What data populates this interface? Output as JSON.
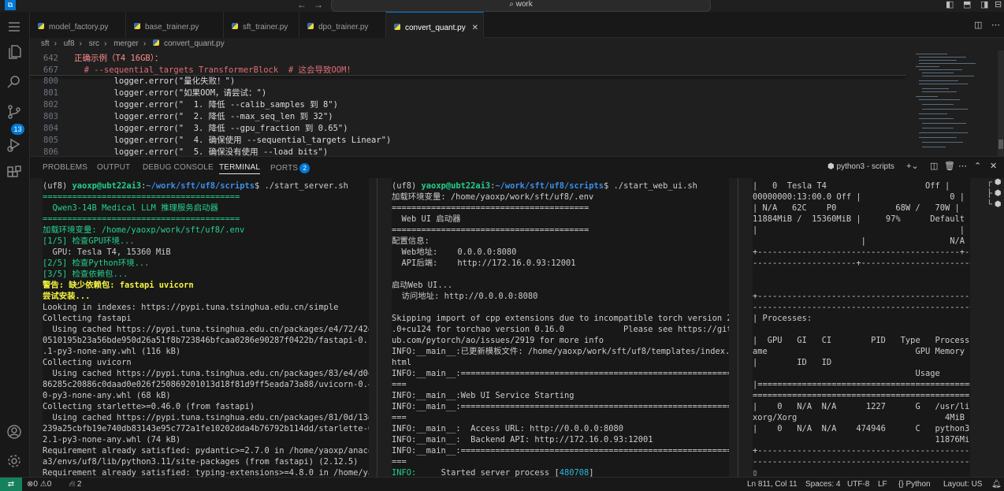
{
  "titlebar": {
    "search": "work"
  },
  "tabs": [
    {
      "label": "model_factory.py"
    },
    {
      "label": "base_trainer.py"
    },
    {
      "label": "sft_trainer.py"
    },
    {
      "label": "dpo_trainer.py"
    },
    {
      "label": "convert_quant.py",
      "active": true
    }
  ],
  "breadcrumb": [
    "sft",
    "uf8",
    "src",
    "merger",
    "convert_quant.py"
  ],
  "activity": {
    "scm_badge": "13"
  },
  "editor": {
    "sticky": [
      {
        "num": "642",
        "text": "正确示例（T4 16GB）："
      },
      {
        "num": "667",
        "text": "  # --sequential_targets TransformerBlock  # 这会导致OOM!"
      }
    ],
    "lines": [
      {
        "num": "800",
        "text": "        logger.error(\"量化失败！\")"
      },
      {
        "num": "801",
        "text": "        logger.error(\"如果OOM，请尝试：\")"
      },
      {
        "num": "802",
        "text": "        logger.error(\"  1. 降低 --calib_samples 到 8\")"
      },
      {
        "num": "803",
        "text": "        logger.error(\"  2. 降低 --max_seq_len 到 32\")"
      },
      {
        "num": "804",
        "text": "        logger.error(\"  3. 降低 --gpu_fraction 到 0.65\")"
      },
      {
        "num": "805",
        "text": "        logger.error(\"  4. 确保使用 --sequential_targets Linear\")"
      },
      {
        "num": "806",
        "text": "        logger.error(\"  5. 确保没有使用 --load_bits\")"
      }
    ]
  },
  "panel": {
    "tabs": [
      "PROBLEMS",
      "OUTPUT",
      "DEBUG CONSOLE",
      "TERMINAL",
      "PORTS"
    ],
    "ports_badge": "2",
    "terminal_selector": "python3 - scripts"
  },
  "terminal1": [
    [
      {
        "t": "(uf8) ",
        "c": "white"
      },
      {
        "t": "yaoxp@ubt22ai3",
        "c": "bgreen"
      },
      {
        "t": ":",
        "c": "white"
      },
      {
        "t": "~/work/sft/uf8/scripts",
        "c": "bblue"
      },
      {
        "t": "$ ./start_server.sh",
        "c": "white"
      }
    ],
    [
      {
        "t": "========================================",
        "c": "green"
      }
    ],
    [
      {
        "t": "  Qwen3-14B Medical LLM 推理服务启动器",
        "c": "green"
      }
    ],
    [
      {
        "t": "========================================",
        "c": "green"
      }
    ],
    [
      {
        "t": "加载环境变量: /home/yaoxp/work/sft/uf8/.env",
        "c": "green"
      }
    ],
    [
      {
        "t": "[1/5] 检查GPU环境...",
        "c": "green"
      }
    ],
    [
      {
        "t": "  GPU: Tesla T4, 15360 MiB",
        "c": "white"
      }
    ],
    [
      {
        "t": "[2/5] 检查Python环境...",
        "c": "green"
      }
    ],
    [
      {
        "t": "[3/5] 检查依赖包...",
        "c": "green"
      }
    ],
    [
      {
        "t": "警告: 缺少依赖包: fastapi uvicorn",
        "c": "yellow"
      }
    ],
    [
      {
        "t": "尝试安装...",
        "c": "yellow"
      }
    ],
    [
      {
        "t": "Looking in indexes: https://pypi.tuna.tsinghua.edu.cn/simple",
        "c": "white"
      }
    ],
    [
      {
        "t": "Collecting fastapi",
        "c": "white"
      }
    ],
    [
      {
        "t": "  Using cached https://pypi.tuna.tsinghua.edu.cn/packages/e4/72/42e90",
        "c": "white"
      }
    ],
    [
      {
        "t": "0510195b23a56bde950d26a51f8b723846bfcaa0286e90287f0422b/fastapi-0.135",
        "c": "white"
      }
    ],
    [
      {
        "t": ".1-py3-none-any.whl (116 kB)",
        "c": "white"
      }
    ],
    [
      {
        "t": "Collecting uvicorn",
        "c": "white"
      }
    ],
    [
      {
        "t": "  Using cached https://pypi.tuna.tsinghua.edu.cn/packages/83/e4/d04a0",
        "c": "white"
      }
    ],
    [
      {
        "t": "86285c20886c0daad0e026f250869201013d18f81d9ff5eada73a88/uvicorn-0.41.",
        "c": "white"
      }
    ],
    [
      {
        "t": "0-py3-none-any.whl (68 kB)",
        "c": "white"
      }
    ],
    [
      {
        "t": "Collecting starlette>=0.46.0 (from fastapi)",
        "c": "white"
      }
    ],
    [
      {
        "t": "  Using cached https://pypi.tuna.tsinghua.edu.cn/packages/81/0d/13d1d",
        "c": "white"
      }
    ],
    [
      {
        "t": "239a25cbfb19e740db83143e95c772a1fe10202dda4b76792b114dd/starlette-0.5",
        "c": "white"
      }
    ],
    [
      {
        "t": "2.1-py3-none-any.whl (74 kB)",
        "c": "white"
      }
    ],
    [
      {
        "t": "Requirement already satisfied: pydantic>=2.7.0 in /home/yaoxp/anacond",
        "c": "white"
      }
    ],
    [
      {
        "t": "a3/envs/uf8/lib/python3.11/site-packages (from fastapi) (2.12.5)",
        "c": "white"
      }
    ],
    [
      {
        "t": "Requirement already satisfied: typing-extensions>=4.8.0 in /home/yaox",
        "c": "white"
      }
    ]
  ],
  "terminal2": [
    [
      {
        "t": "(uf8) ",
        "c": "white"
      },
      {
        "t": "yaoxp@ubt22ai3",
        "c": "bgreen"
      },
      {
        "t": ":",
        "c": "white"
      },
      {
        "t": "~/work/sft/uf8/scripts",
        "c": "bblue"
      },
      {
        "t": "$ ./start_web_ui.sh",
        "c": "white"
      }
    ],
    [
      {
        "t": "加载环境变量: /home/yaoxp/work/sft/uf8/.env",
        "c": "white"
      }
    ],
    [
      {
        "t": "========================================",
        "c": "white"
      }
    ],
    [
      {
        "t": "  Web UI 启动器",
        "c": "white"
      }
    ],
    [
      {
        "t": "========================================",
        "c": "white"
      }
    ],
    [
      {
        "t": "配置信息:",
        "c": "white"
      }
    ],
    [
      {
        "t": "  Web地址:    0.0.0.0:8080",
        "c": "white"
      }
    ],
    [
      {
        "t": "  API后端:    http://172.16.0.93:12001",
        "c": "white"
      }
    ],
    [
      {
        "t": "",
        "c": "white"
      }
    ],
    [
      {
        "t": "启动Web UI...",
        "c": "white"
      }
    ],
    [
      {
        "t": "  访问地址: http://0.0.0.0:8080",
        "c": "white"
      }
    ],
    [
      {
        "t": "",
        "c": "white"
      }
    ],
    [
      {
        "t": "Skipping import of cpp extensions due to incompatible torch version 2.6",
        "c": "white"
      }
    ],
    [
      {
        "t": ".0+cu124 for torchao version 0.16.0            Please see https://gith",
        "c": "white"
      }
    ],
    [
      {
        "t": "ub.com/pytorch/ao/issues/2919 for more info",
        "c": "white"
      }
    ],
    [
      {
        "t": "INFO:__main__:已更新模板文件: /home/yaoxp/work/sft/uf8/templates/index.",
        "c": "white"
      }
    ],
    [
      {
        "t": "html",
        "c": "white"
      }
    ],
    [
      {
        "t": "INFO:__main__:==========================================================",
        "c": "white"
      }
    ],
    [
      {
        "t": "===",
        "c": "white"
      }
    ],
    [
      {
        "t": "INFO:__main__:Web UI Service Starting",
        "c": "white"
      }
    ],
    [
      {
        "t": "INFO:__main__:==========================================================",
        "c": "white"
      }
    ],
    [
      {
        "t": "===",
        "c": "white"
      }
    ],
    [
      {
        "t": "INFO:__main__:  Access URL: http://0.0.0.0:8080",
        "c": "white"
      }
    ],
    [
      {
        "t": "INFO:__main__:  Backend API: http://172.16.0.93:12001",
        "c": "white"
      }
    ],
    [
      {
        "t": "INFO:__main__:==========================================================",
        "c": "white"
      }
    ],
    [
      {
        "t": "===",
        "c": "white"
      }
    ],
    [
      {
        "t": "INFO:     ",
        "c": "green"
      },
      {
        "t": "Started server process [",
        "c": "white"
      },
      {
        "t": "480708",
        "c": "cyan"
      },
      {
        "t": "]",
        "c": "white"
      }
    ]
  ],
  "terminal3": [
    [
      {
        "t": "|   0  Tesla T4                    Off |",
        "c": "white"
      }
    ],
    [
      {
        "t": "00000000:13:00.0 Off |                  0 |",
        "c": "white"
      }
    ],
    [
      {
        "t": "| N/A   62C    P0            68W /   70W |",
        "c": "white"
      }
    ],
    [
      {
        "t": "11884MiB /  15360MiB |     97%      Default |",
        "c": "white"
      }
    ],
    [
      {
        "t": "|                                         |",
        "c": "white"
      }
    ],
    [
      {
        "t": "                      |                 N/A |",
        "c": "white"
      }
    ],
    [
      {
        "t": "+-----------------------------------------+---",
        "c": "white"
      }
    ],
    [
      {
        "t": "---------------------+----------------------+",
        "c": "white"
      }
    ],
    [
      {
        "t": "",
        "c": "white"
      }
    ],
    [
      {
        "t": "",
        "c": "white"
      }
    ],
    [
      {
        "t": "+---------------------------------------------",
        "c": "white"
      }
    ],
    [
      {
        "t": "--------------------------------------------+",
        "c": "white"
      }
    ],
    [
      {
        "t": "| Processes:                                  ",
        "c": "white"
      }
    ],
    [
      {
        "t": "                                             |",
        "c": "white"
      }
    ],
    [
      {
        "t": "|  GPU   GI   CI        PID   Type   Process n",
        "c": "white"
      }
    ],
    [
      {
        "t": "ame                              GPU Memory |",
        "c": "white"
      }
    ],
    [
      {
        "t": "|        ID   ID                              ",
        "c": "white"
      }
    ],
    [
      {
        "t": "                                 Usage      |",
        "c": "white"
      }
    ],
    [
      {
        "t": "|=============================================",
        "c": "white"
      }
    ],
    [
      {
        "t": "============================================|",
        "c": "white"
      }
    ],
    [
      {
        "t": "|    0   N/A  N/A      1227      G   /usr/lib/",
        "c": "white"
      }
    ],
    [
      {
        "t": "xorg/Xorg                              4MiB |",
        "c": "white"
      }
    ],
    [
      {
        "t": "|    0   N/A  N/A    474946      C   python3  ",
        "c": "white"
      }
    ],
    [
      {
        "t": "                                     11876MiB |",
        "c": "white"
      }
    ],
    [
      {
        "t": "+---------------------------------------------",
        "c": "white"
      }
    ],
    [
      {
        "t": "--------------------------------------------+",
        "c": "white"
      }
    ],
    [
      {
        "t": "▯",
        "c": "white"
      }
    ]
  ],
  "statusbar": {
    "errors": "0",
    "warnings": "0",
    "ports": "2",
    "position": "Ln 811, Col 11",
    "spaces": "Spaces: 4",
    "encoding": "UTF-8",
    "eol": "LF",
    "language": "Python",
    "layout": "Layout: US"
  }
}
